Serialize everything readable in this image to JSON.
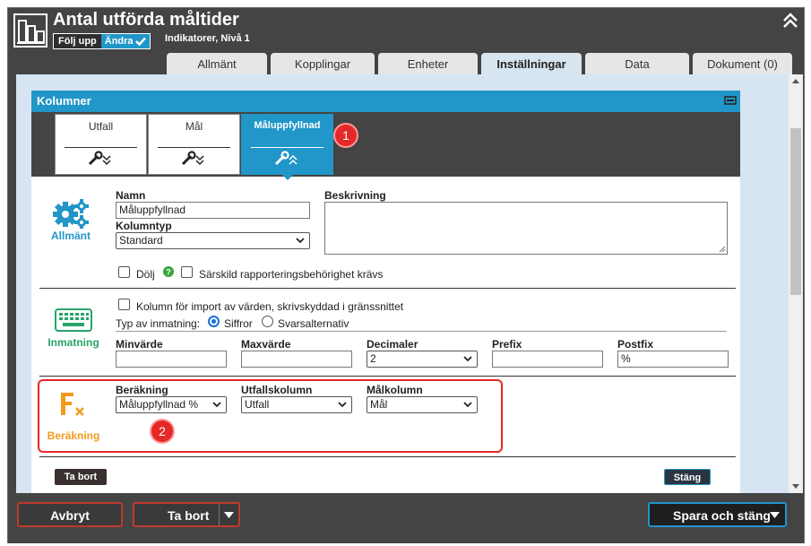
{
  "header": {
    "title": "Antal utförda måltider",
    "follow_label": "Följ upp",
    "change_label": "Ändra",
    "subtitle": "Indikatorer, Nivå 1"
  },
  "tabs": [
    {
      "label": "Allmänt",
      "active": false
    },
    {
      "label": "Kopplingar",
      "active": false
    },
    {
      "label": "Enheter",
      "active": false
    },
    {
      "label": "Inställningar",
      "active": true
    },
    {
      "label": "Data",
      "active": false
    },
    {
      "label": "Dokument (0)",
      "active": false
    }
  ],
  "panel": {
    "title": "Kolumner",
    "columns": [
      {
        "label": "Utfall",
        "active": false
      },
      {
        "label": "Mål",
        "active": false
      },
      {
        "label": "Måluppfyllnad",
        "active": true
      }
    ]
  },
  "markers": {
    "one": "1",
    "two": "2"
  },
  "general": {
    "section_label": "Allmänt",
    "name_label": "Namn",
    "name_value": "Måluppfyllnad",
    "type_label": "Kolumntyp",
    "type_value": "Standard",
    "description_label": "Beskrivning",
    "hide_label": "Dölj",
    "special_label": "Särskild rapporteringsbehörighet krävs"
  },
  "input": {
    "section_label": "Inmatning",
    "import_label": "Kolumn för import av värden, skrivskyddad i gränssnittet",
    "input_type_label": "Typ av inmatning:",
    "option_numbers": "Siffror",
    "option_answers": "Svarsalternativ",
    "min_label": "Minvärde",
    "min_value": "",
    "max_label": "Maxvärde",
    "max_value": "",
    "decimals_label": "Decimaler",
    "decimals_value": "2",
    "prefix_label": "Prefix",
    "prefix_value": "",
    "postfix_label": "Postfix",
    "postfix_value": "%"
  },
  "calc": {
    "section_label": "Beräkning",
    "calc_label": "Beräkning",
    "calc_value": "Måluppfyllnad %",
    "outcome_label": "Utfallskolumn",
    "outcome_value": "Utfall",
    "target_label": "Målkolumn",
    "target_value": "Mål"
  },
  "panel_actions": {
    "delete": "Ta bort",
    "close": "Stäng"
  },
  "footer": {
    "cancel": "Avbryt",
    "delete": "Ta bort",
    "save": "Spara och stäng"
  },
  "colors": {
    "accent": "#2196c8",
    "header_bg": "#444444",
    "marker": "#e52828",
    "calc_orange": "#f29b1d",
    "input_green": "#29a36a"
  }
}
